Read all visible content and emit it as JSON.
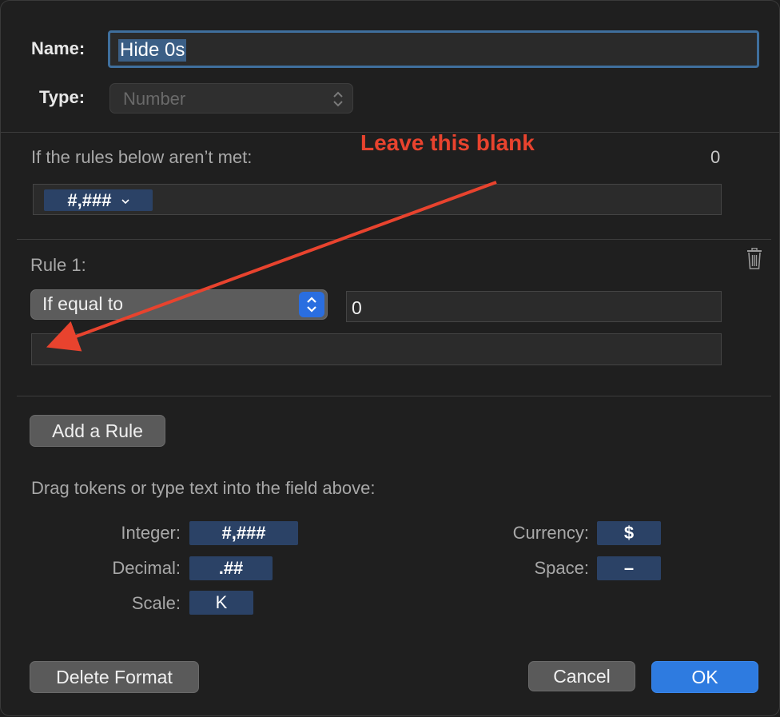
{
  "form": {
    "name_label": "Name:",
    "name_value": "Hide 0s",
    "type_label": "Type:",
    "type_value": "Number"
  },
  "default_rule": {
    "label": "If the rules below aren’t met:",
    "preview": "0",
    "token": "#,###"
  },
  "rule1": {
    "label": "Rule 1:",
    "condition": "If equal to",
    "value": "0",
    "format_value": ""
  },
  "buttons": {
    "add_rule": "Add a Rule",
    "delete_format": "Delete Format",
    "cancel": "Cancel",
    "ok": "OK"
  },
  "tokens_help": "Drag tokens or type text into the field above:",
  "tokens": {
    "integer_label": "Integer:",
    "integer_token": "#,###",
    "decimal_label": "Decimal:",
    "decimal_token": ".##",
    "scale_label": "Scale:",
    "scale_token": "K",
    "currency_label": "Currency:",
    "currency_token": "$",
    "space_label": "Space:",
    "space_token": "–"
  },
  "annotation": {
    "text": "Leave this blank",
    "color": "#e8432e"
  },
  "icons": {
    "trash": "trash-icon",
    "type_updown": "chevron-updown-icon",
    "token_dropdown": "chevron-down-icon",
    "condition_stepper": "chevron-updown-icon"
  }
}
